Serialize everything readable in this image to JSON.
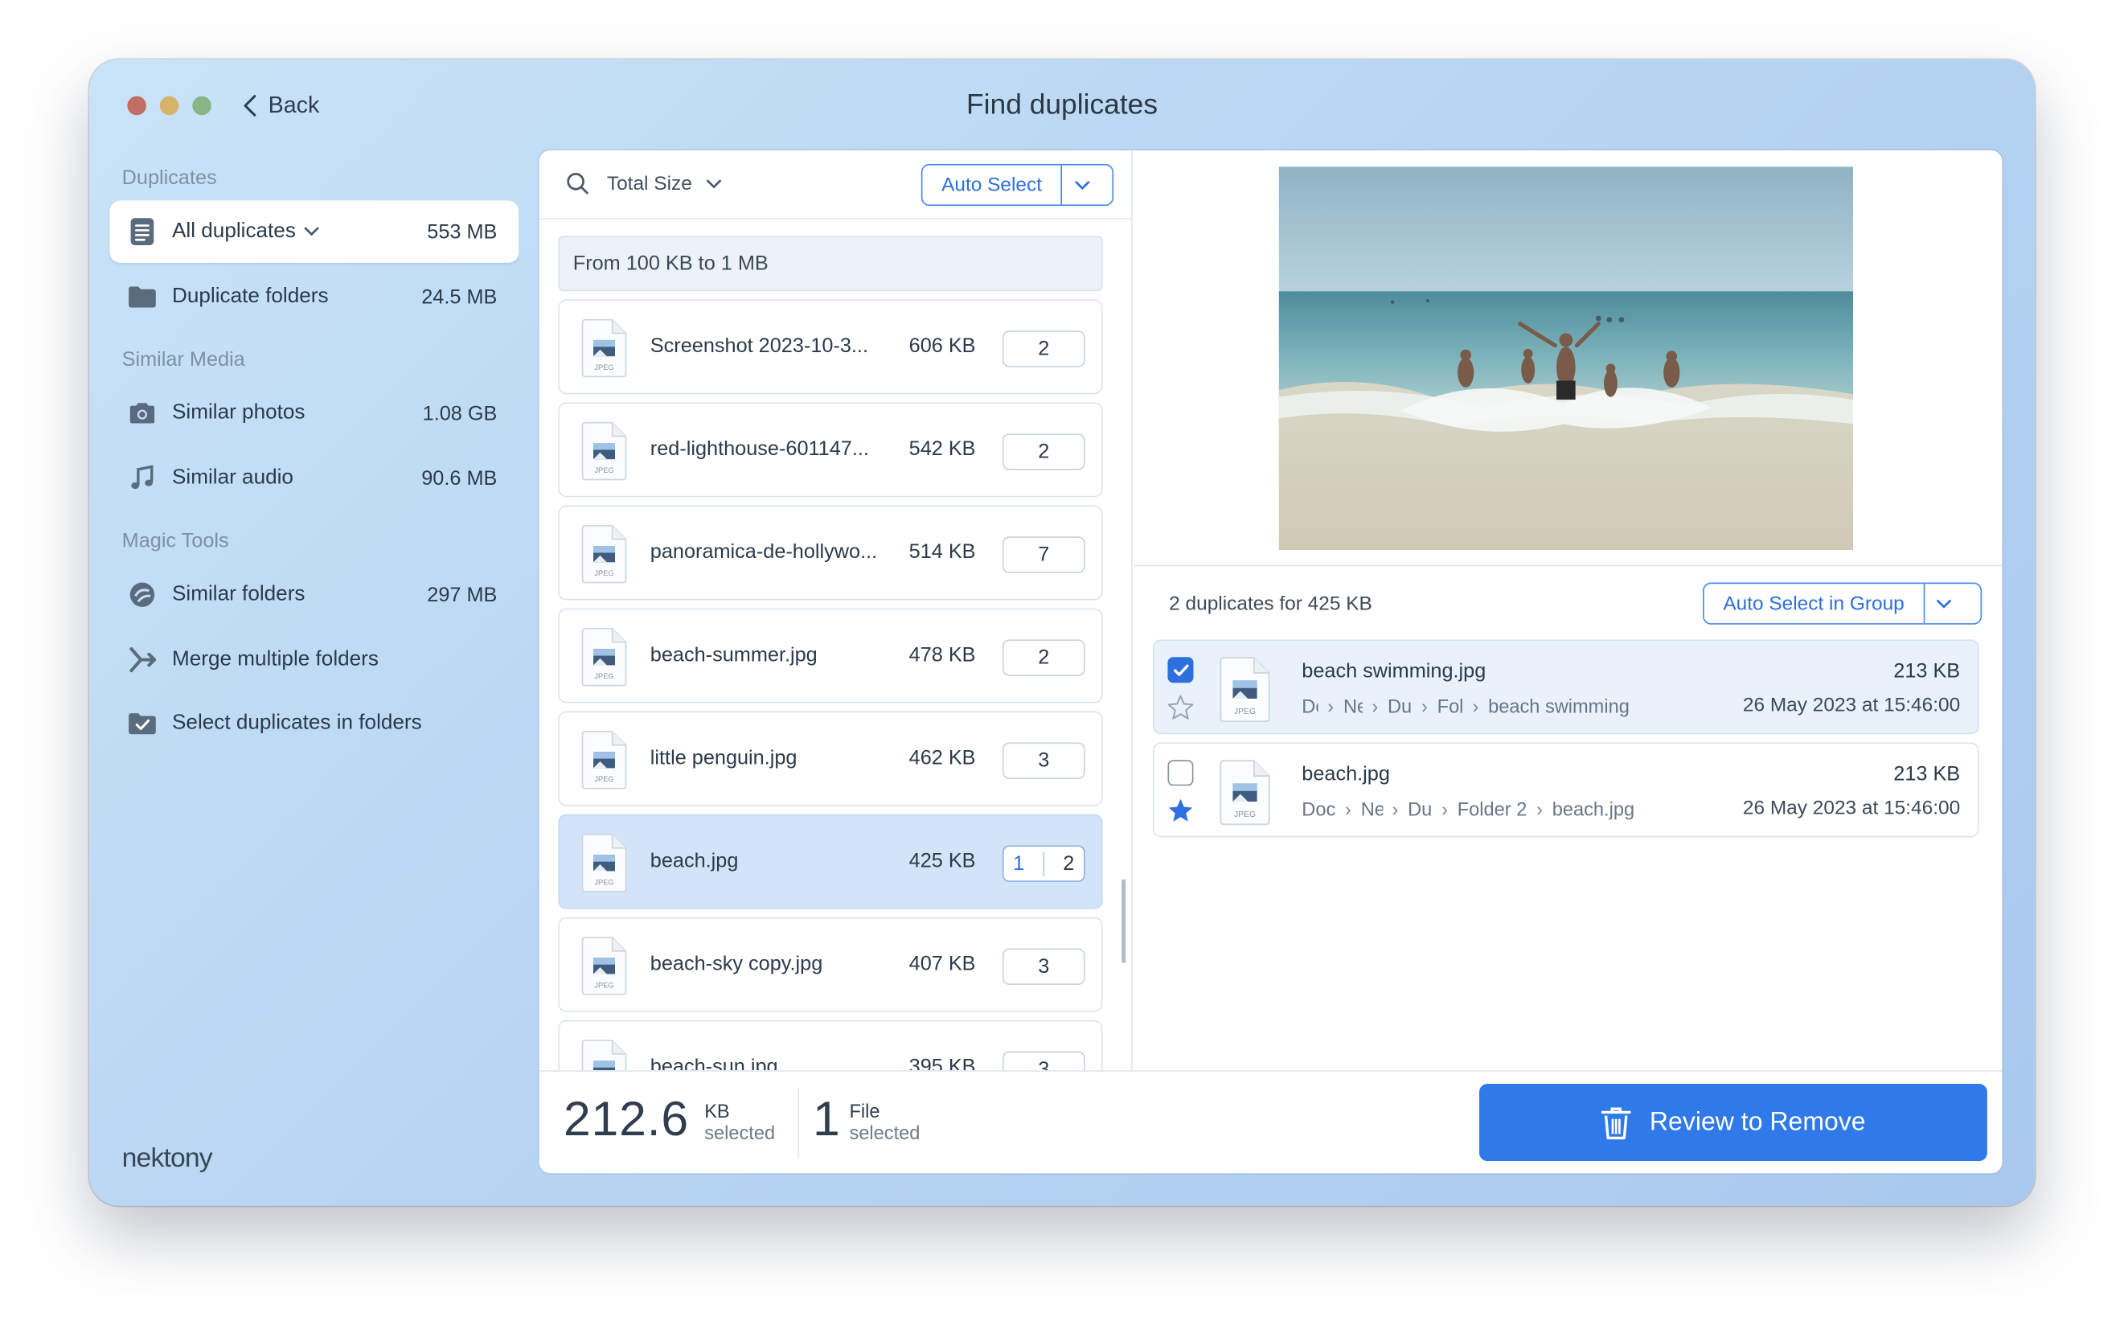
{
  "window": {
    "title": "Find duplicates",
    "back_label": "Back"
  },
  "sidebar": {
    "sections": [
      {
        "title": "Duplicates"
      },
      {
        "title": "Similar Media"
      },
      {
        "title": "Magic Tools"
      }
    ],
    "items": [
      {
        "label": "All duplicates",
        "value": "553 MB",
        "icon": "document-list-icon",
        "active": true
      },
      {
        "label": "Duplicate folders",
        "value": "24.5 MB",
        "icon": "folder-icon"
      },
      {
        "label": "Similar photos",
        "value": "1.08 GB",
        "icon": "camera-icon"
      },
      {
        "label": "Similar audio",
        "value": "90.6 MB",
        "icon": "music-note-icon"
      },
      {
        "label": "Similar folders",
        "value": "297 MB",
        "icon": "similar-folders-icon"
      },
      {
        "label": "Merge multiple folders",
        "value": "",
        "icon": "merge-icon"
      },
      {
        "label": "Select duplicates in folders",
        "value": "",
        "icon": "folder-check-icon"
      }
    ],
    "logo": "nektony"
  },
  "toolbar": {
    "sort_label": "Total Size",
    "auto_select": "Auto Select"
  },
  "list": {
    "group_header": "From 100 KB to 1 MB",
    "rows": [
      {
        "name": "Screenshot 2023-10-3...",
        "size": "606 KB",
        "count": "2"
      },
      {
        "name": "red-lighthouse-601147...",
        "size": "542 KB",
        "count": "2"
      },
      {
        "name": "panoramica-de-hollywo...",
        "size": "514 KB",
        "count": "7"
      },
      {
        "name": "beach-summer.jpg",
        "size": "478 KB",
        "count": "2"
      },
      {
        "name": "little penguin.jpg",
        "size": "462 KB",
        "count": "3"
      },
      {
        "name": "beach.jpg",
        "size": "425 KB",
        "count_selected": "1",
        "count": "2",
        "selected": true
      },
      {
        "name": "beach-sky copy.jpg",
        "size": "407 KB",
        "count": "3"
      },
      {
        "name": "beach-sun.jpg",
        "size": "395 KB",
        "count": "3"
      }
    ]
  },
  "detail": {
    "summary": "2 duplicates for 425 KB",
    "auto_select_group": "Auto Select in Group",
    "items": [
      {
        "name": "beach swimming.jpg",
        "size": "213 KB",
        "date": "26 May 2023 at 15:46:00",
        "checked": true,
        "starred": false,
        "path": [
          "Do",
          "Ne",
          "Du",
          "Fol",
          "beach swimming"
        ]
      },
      {
        "name": "beach.jpg",
        "size": "213 KB",
        "date": "26 May 2023 at 15:46:00",
        "checked": false,
        "starred": true,
        "path": [
          "Doc",
          "Ne",
          "Du",
          "Folder 2",
          "beach.jpg"
        ]
      }
    ]
  },
  "footer": {
    "size_value": "212.6",
    "size_unit": "KB",
    "size_sub": "selected",
    "files_value": "1",
    "files_unit": "File",
    "files_sub": "selected",
    "review_label": "Review to Remove"
  },
  "colors": {
    "accent": "#2f7ae8",
    "selected_row": "#d3e4f9",
    "sidebar_bg": "#bad7f3"
  }
}
